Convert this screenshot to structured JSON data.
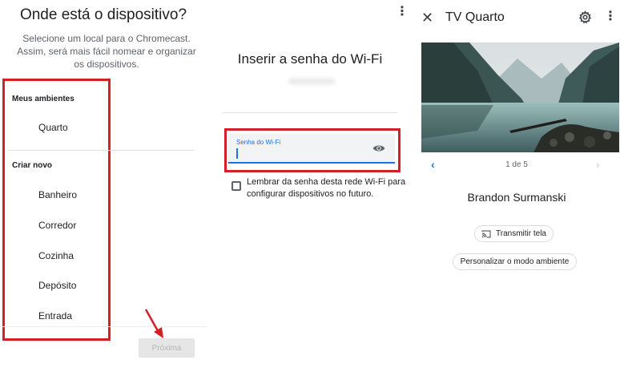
{
  "panel1": {
    "title": "Onde está o dispositivo?",
    "description": "Selecione um local para o Chromecast. Assim, será mais fácil nomear e organizar os dispositivos.",
    "my_rooms_heading": "Meus ambientes",
    "my_rooms": [
      "Quarto"
    ],
    "create_new_heading": "Criar novo",
    "new_rooms": [
      "Banheiro",
      "Corredor",
      "Cozinha",
      "Depósito",
      "Entrada"
    ],
    "next_button": "Próxima",
    "highlight_color": "#d32027"
  },
  "panel2": {
    "title": "Inserir a senha do Wi-Fi",
    "password_label": "Senha do Wi-Fi",
    "remember_text": "Lembrar da senha desta rede Wi-Fi para configurar dispositivos no futuro.",
    "remember_checked": false,
    "icons": [
      "more-vert-icon",
      "eye-icon"
    ]
  },
  "panel3": {
    "title": "TV Quarto",
    "counter": "1 de 5",
    "photographer": "Brandon Surmanski",
    "cast_button": "Transmitir tela",
    "ambient_button": "Personalizar o modo ambiente",
    "icons": [
      "close-icon",
      "gear-icon",
      "more-vert-icon",
      "chevron-left-icon",
      "chevron-right-icon",
      "cast-icon"
    ],
    "accent": "#1a73e8"
  }
}
